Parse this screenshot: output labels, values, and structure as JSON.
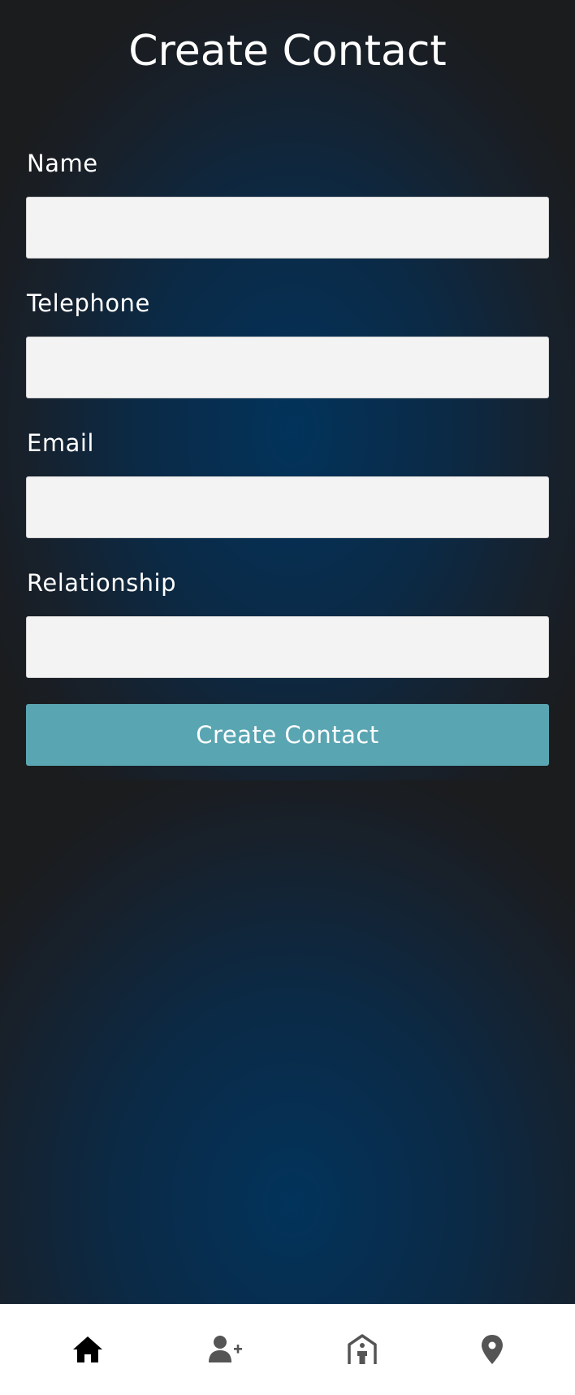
{
  "header": {
    "title": "Create Contact"
  },
  "form": {
    "fields": [
      {
        "label": "Name",
        "value": "",
        "placeholder": ""
      },
      {
        "label": "Telephone",
        "value": "",
        "placeholder": ""
      },
      {
        "label": "Email",
        "value": "",
        "placeholder": ""
      },
      {
        "label": "Relationship",
        "value": "",
        "placeholder": ""
      }
    ],
    "submit_label": "Create Contact"
  },
  "bottom_nav": {
    "items": [
      {
        "icon": "home-icon",
        "active": true
      },
      {
        "icon": "add-user-icon",
        "active": false
      },
      {
        "icon": "shelter-icon",
        "active": false
      },
      {
        "icon": "map-pin-icon",
        "active": false
      }
    ]
  },
  "colors": {
    "background_dark": "#1b1c1e",
    "background_blue": "#02335b",
    "input_background": "#f3f3f4",
    "button_accent": "#5aa5b2",
    "nav_active": "#000000",
    "nav_inactive": "#555555"
  }
}
